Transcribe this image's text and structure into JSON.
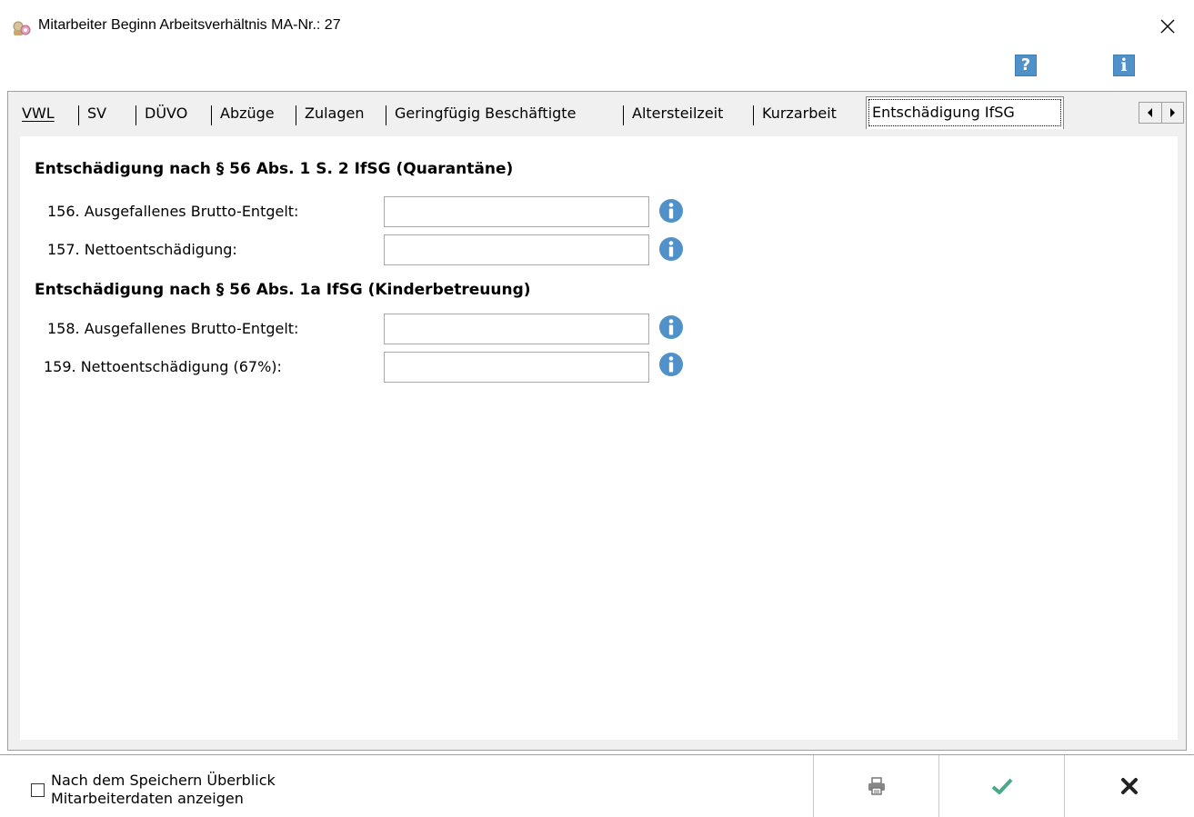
{
  "window": {
    "title": "Mitarbeiter Beginn Arbeitsverhältnis MA-Nr.: 27"
  },
  "toolbar": {
    "help_icon": "?",
    "info_icon": "i"
  },
  "tabs": [
    {
      "label": "VWL"
    },
    {
      "label": "SV"
    },
    {
      "label": "DÜVO"
    },
    {
      "label": "Abzüge"
    },
    {
      "label": "Zulagen"
    },
    {
      "label": "Geringfügig Beschäftigte"
    },
    {
      "label": "Altersteilzeit"
    },
    {
      "label": "Kurzarbeit"
    },
    {
      "label": "Entschädigung IfSG",
      "active": true
    }
  ],
  "sections": [
    {
      "title": "Entschädigung nach § 56 Abs. 1 S. 2 IfSG (Quarantäne)",
      "fields": [
        {
          "label": "156. Ausgefallenes Brutto-Entgelt:",
          "value": ""
        },
        {
          "label": "157. Nettoentschädigung:",
          "value": ""
        }
      ]
    },
    {
      "title": "Entschädigung nach § 56 Abs. 1a IfSG (Kinderbetreuung)",
      "fields": [
        {
          "label": "158. Ausgefallenes Brutto-Entgelt:",
          "value": ""
        },
        {
          "label": "159. Nettoentschädigung (67%):",
          "value": ""
        }
      ]
    }
  ],
  "footer": {
    "checkbox_label": "Nach dem Speichern Überblick Mitarbeiterdaten anzeigen",
    "checkbox_checked": false
  },
  "colors": {
    "accent_blue": "#4f91c8",
    "check_green": "#4aa98a"
  }
}
